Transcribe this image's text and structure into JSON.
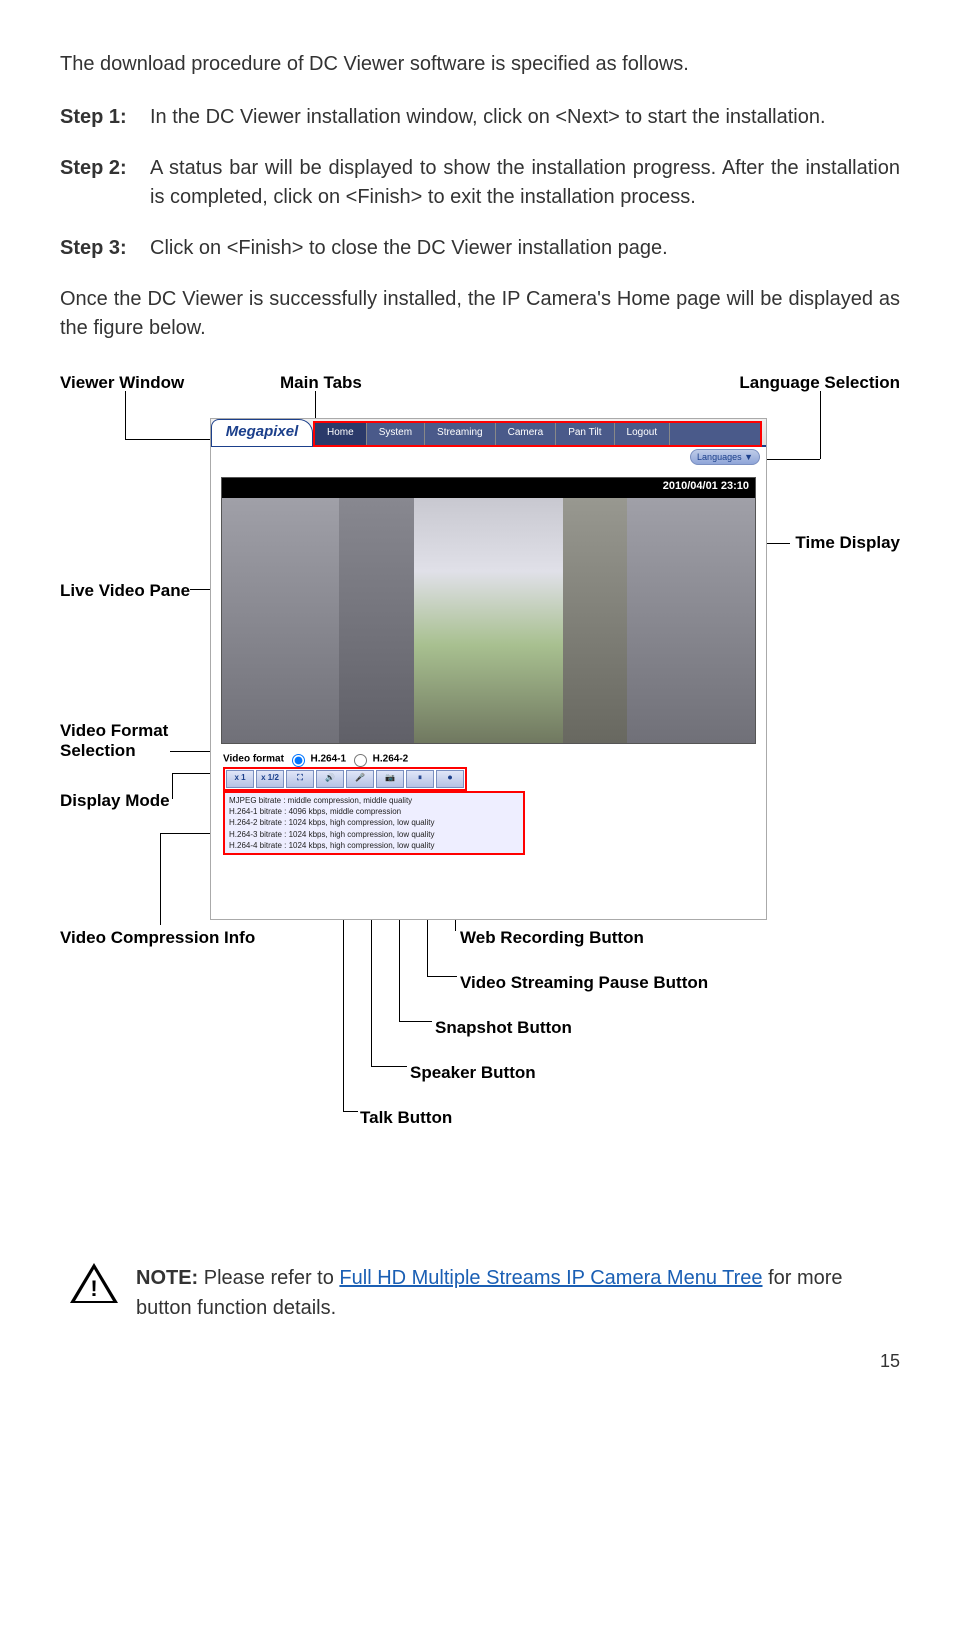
{
  "intro": "The download procedure of DC Viewer software is specified as follows.",
  "steps": [
    {
      "label": "Step 1:",
      "text": "In the DC Viewer installation window, click on <Next> to start the installation."
    },
    {
      "label": "Step 2:",
      "text": "A status bar will be displayed to show the installation progress. After the installation is completed, click on <Finish> to exit the installation process."
    },
    {
      "label": "Step 3:",
      "text": "Click on <Finish> to close the DC Viewer installation page."
    }
  ],
  "conclusion": "Once the DC Viewer is successfully installed, the IP Camera's Home page will be displayed as the figure below.",
  "callouts": {
    "viewer_window": "Viewer Window",
    "main_tabs": "Main Tabs",
    "language_selection": "Language Selection",
    "live_video_pane": "Live Video Pane",
    "time_display": "Time Display",
    "video_format_selection": "Video Format\nSelection",
    "display_mode": "Display Mode",
    "video_compression_info": "Video Compression Info",
    "web_recording_button": "Web Recording Button",
    "video_streaming_pause_button": "Video Streaming Pause Button",
    "snapshot_button": "Snapshot Button",
    "speaker_button": "Speaker Button",
    "talk_button": "Talk Button"
  },
  "ui": {
    "logo": "Megapixel",
    "tabs": [
      "Home",
      "System",
      "Streaming",
      "Camera",
      "Pan Tilt",
      "Logout"
    ],
    "languages": "Languages ▼",
    "timestamp": "2010/04/01 23:10",
    "video_format_label": "Video format",
    "vf_options": [
      "H.264-1",
      "H.264-2"
    ],
    "display_buttons": [
      "x 1",
      "x 1/2",
      "⛶",
      "🔊",
      "🎤",
      "📷",
      "⏸",
      "⏺"
    ],
    "compression_lines": [
      "MJPEG bitrate : middle compression, middle quality",
      "H.264-1 bitrate : 4096 kbps, middle compression",
      "H.264-2 bitrate : 1024 kbps, high compression, low quality",
      "H.264-3 bitrate : 1024 kbps, high compression, low quality",
      "H.264-4 bitrate : 1024 kbps, high compression, low quality"
    ]
  },
  "note": {
    "prefix": "NOTE:",
    "body_before": " Please refer to ",
    "link": "Full HD Multiple Streams IP Camera Menu Tree",
    "body_after": " for more button function details."
  },
  "page_number": "15"
}
